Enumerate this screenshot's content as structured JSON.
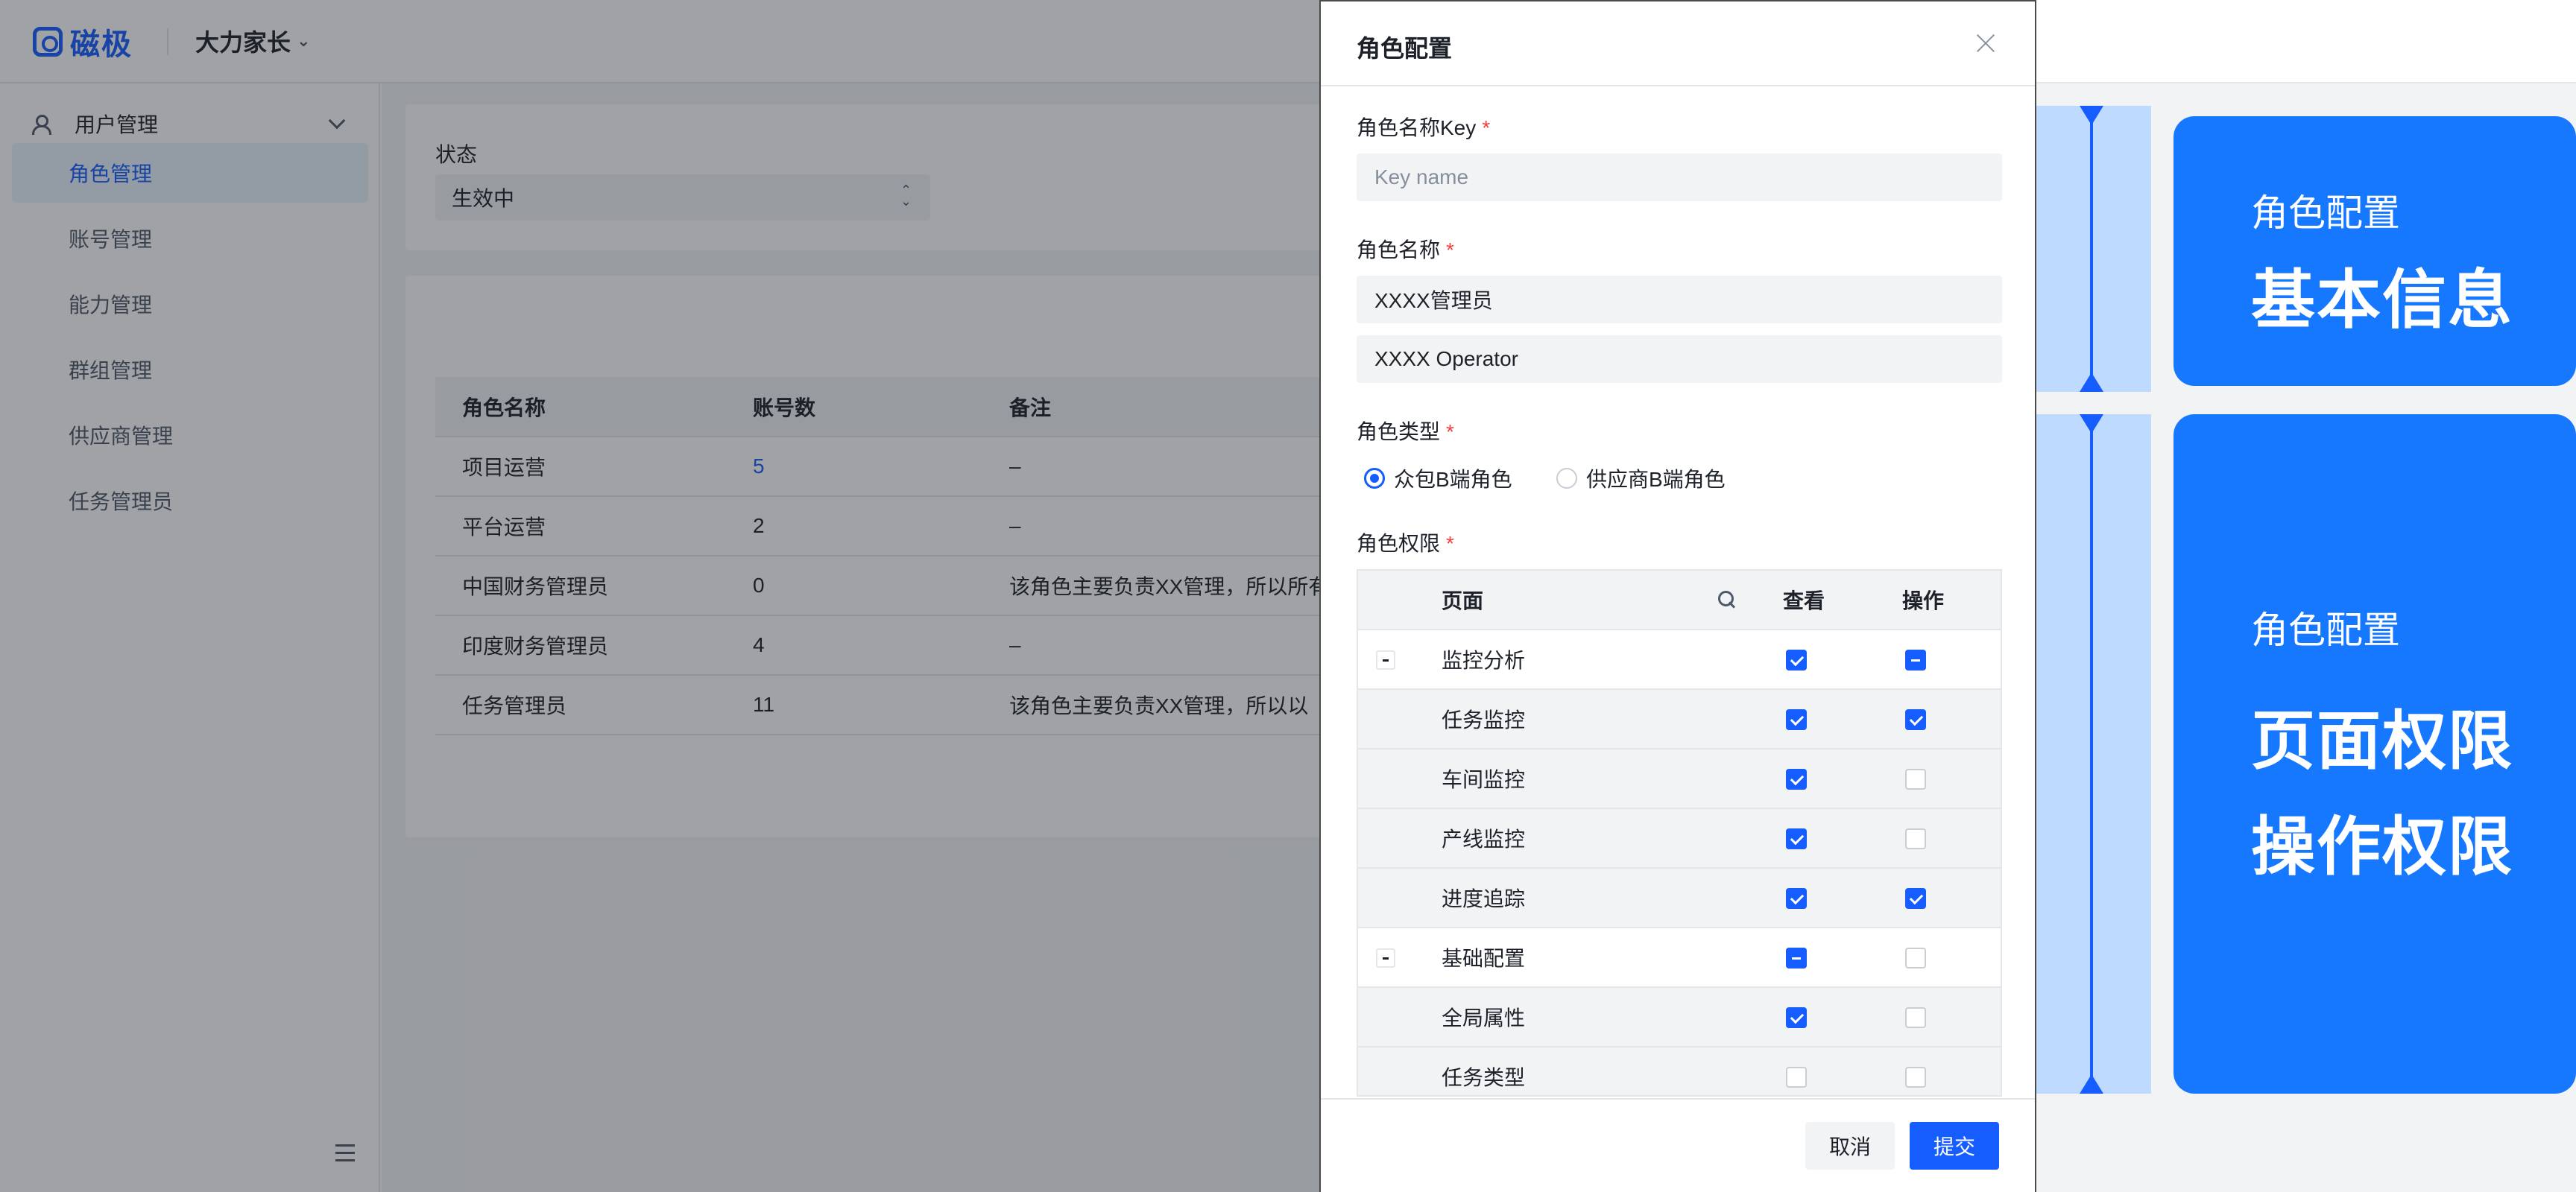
{
  "app": {
    "logo_text": "磁极",
    "project_name": "大力家长"
  },
  "sidebar": {
    "group_label": "用户管理",
    "items": [
      {
        "label": "角色管理",
        "active": true
      },
      {
        "label": "账号管理"
      },
      {
        "label": "能力管理"
      },
      {
        "label": "群组管理"
      },
      {
        "label": "供应商管理"
      },
      {
        "label": "任务管理员"
      }
    ]
  },
  "filter": {
    "status_label": "状态",
    "status_value": "生效中"
  },
  "role_table": {
    "columns": [
      "角色名称",
      "账号数",
      "备注"
    ],
    "rows": [
      [
        "项目运营",
        "5",
        "–"
      ],
      [
        "平台运营",
        "2",
        "–"
      ],
      [
        "中国财务管理员",
        "0",
        "该角色主要负责XX管理，所以所有"
      ],
      [
        "印度财务管理员",
        "4",
        "–"
      ],
      [
        "任务管理员",
        "11",
        "该角色主要负责XX管理，所以以"
      ]
    ]
  },
  "drawer": {
    "title": "角色配置",
    "key_label": "角色名称Key",
    "key_placeholder": "Key name",
    "name_label": "角色名称",
    "name_cn": "XXXX管理员",
    "name_en": "XXXX Operator",
    "type_label": "角色类型",
    "type_options": [
      "众包B端角色",
      "供应商B端角色"
    ],
    "type_selected": "众包B端角色",
    "perm_label": "角色权限",
    "required_mark": "*",
    "perm_columns": {
      "page": "页面",
      "view": "查看",
      "operate": "操作"
    },
    "perm_rows": [
      {
        "name": "监控分析",
        "group": true,
        "view": "checked",
        "operate": "partial"
      },
      {
        "name": "任务监控",
        "group": false,
        "view": "checked",
        "operate": "checked"
      },
      {
        "name": "车间监控",
        "group": false,
        "view": "checked",
        "operate": "off"
      },
      {
        "name": "产线监控",
        "group": false,
        "view": "checked",
        "operate": "off"
      },
      {
        "name": "进度追踪",
        "group": false,
        "view": "checked",
        "operate": "checked"
      },
      {
        "name": "基础配置",
        "group": true,
        "view": "partial",
        "operate": "off"
      },
      {
        "name": "全局属性",
        "group": false,
        "view": "checked",
        "operate": "off"
      },
      {
        "name": "任务类型",
        "group": false,
        "view": "off",
        "operate": "off"
      }
    ],
    "cancel_label": "取消",
    "submit_label": "提交"
  },
  "annotations": {
    "card1": {
      "small": "角色配置",
      "big": [
        "基本信息"
      ]
    },
    "card2": {
      "small": "角色配置",
      "big": [
        "页面权限",
        "操作权限"
      ]
    }
  },
  "colors": {
    "primary": "#165dff",
    "annotation_card": "#1677ff",
    "annotation_bracket": "#bedaff",
    "required": "#f53f3f"
  }
}
